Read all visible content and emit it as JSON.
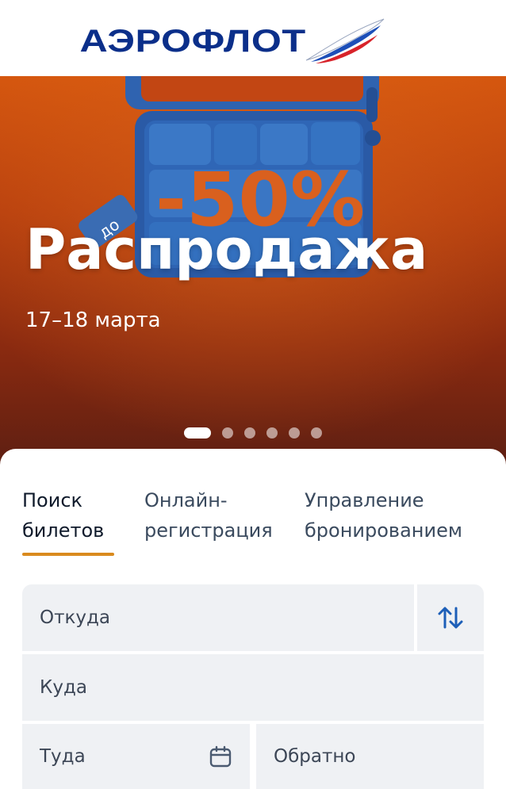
{
  "header": {
    "logo_text": "АЭРОФЛОТ"
  },
  "banner": {
    "discount_text": "до",
    "discount_value": "-50%",
    "title": "Распродажа",
    "dates": "17–18 марта",
    "slide_count": 6,
    "active_slide": 1
  },
  "tabs": [
    {
      "line1": "Поиск",
      "line2": "билетов",
      "active": true
    },
    {
      "line1": "Онлайн-",
      "line2": "регистрация",
      "active": false
    },
    {
      "line1": "Управление",
      "line2": "бронированием",
      "active": false
    }
  ],
  "search_form": {
    "from_placeholder": "Откуда",
    "to_placeholder": "Куда",
    "depart_placeholder": "Туда",
    "return_placeholder": "Обратно",
    "swap_icon": "swap-vertical-arrows-icon",
    "calendar_icon": "calendar-icon"
  },
  "colors": {
    "brand_blue": "#0b2f8a",
    "accent_orange": "#d98a1e",
    "icon_blue": "#1d5fb8",
    "field_bg": "#eff1f4"
  }
}
